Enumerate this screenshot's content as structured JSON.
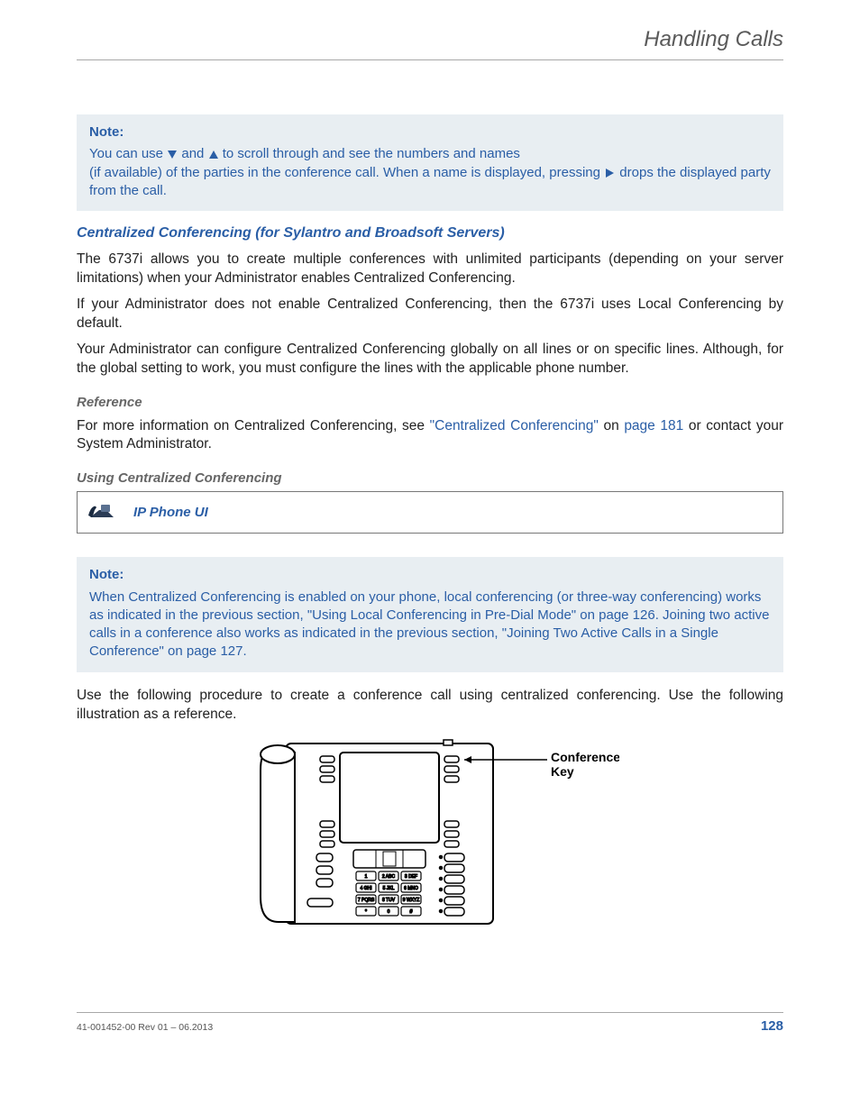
{
  "header": {
    "title": "Handling Calls"
  },
  "note1": {
    "title": "Note:",
    "line1a": "You can use ",
    "line1b": " and ",
    "line1c": " to scroll through and see the numbers and names",
    "line2a": "(if available) of the parties in the conference call. When a name is displayed, pressing ",
    "line2b": " drops the displayed party from the call."
  },
  "h1": "Centralized Conferencing (for Sylantro and Broadsoft Servers)",
  "p1": "The 6737i allows you to create multiple conferences with unlimited participants (depending on your server limitations) when your Administrator enables Centralized Conferencing.",
  "p2": "If your Administrator does not enable Centralized Conferencing, then the 6737i uses Local Conferencing by default.",
  "p3": "Your Administrator can configure Centralized Conferencing globally on all lines or on specific lines. Although, for the global setting to work, you must configure the lines with the applicable phone number.",
  "h2": "Reference",
  "p4a": "For more information on Centralized Conferencing, see ",
  "p4link1": "\"Centralized Conferencing\"",
  "p4b": " on ",
  "p4link2": "page 181",
  "p4c": " or contact your System Administrator.",
  "h3": "Using Centralized Conferencing",
  "uiBar": "IP Phone UI",
  "note2": {
    "title": "Note:",
    "a": "When Centralized Conferencing is enabled on your phone, local conferencing (or three-way conferencing) works as indicated in the previous section, ",
    "link1": "\"Using Local Conferencing in Pre-Dial Mode\"",
    "b": " on ",
    "link2": "page 126",
    "c": ". Joining two active calls in a conference also works as indicated in the previous section, ",
    "link3": "\"Joining Two Active Calls in a Single Conference\"",
    "d": " on ",
    "link4": "page 127",
    "e": "."
  },
  "p5": "Use the following procedure to create a conference call using centralized conferencing. Use the following illustration as a reference.",
  "figure": {
    "callout1": "Conference",
    "callout2": "Key"
  },
  "footer": {
    "rev": "41-001452-00 Rev 01 – 06.2013",
    "page": "128"
  }
}
